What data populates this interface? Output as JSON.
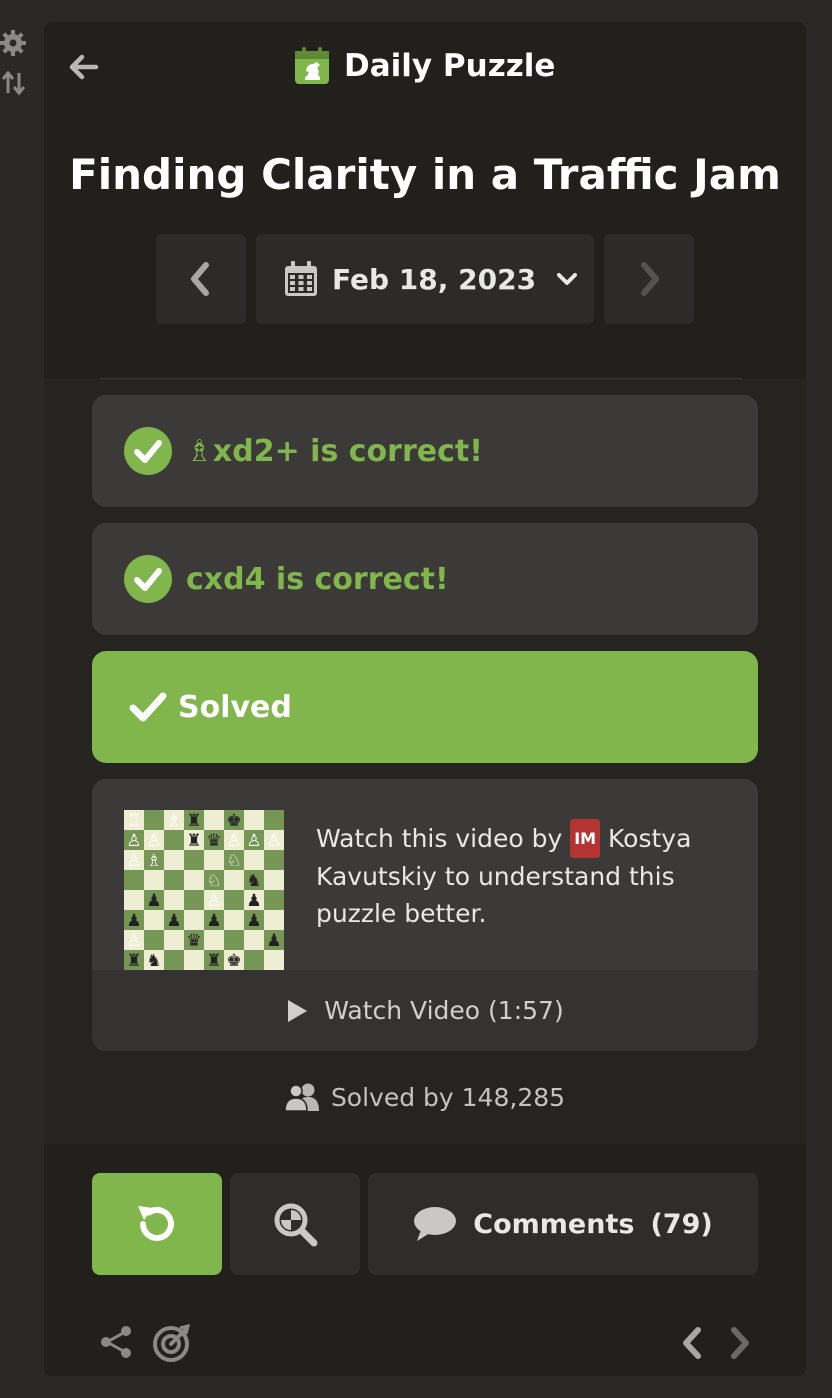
{
  "header": {
    "title": "Daily Puzzle",
    "puzzle_title": "Finding Clarity in a Traffic Jam",
    "date": "Feb 18, 2023"
  },
  "moves": [
    {
      "piece_glyph": "♗",
      "text": "xd2+ is correct!"
    },
    {
      "piece_glyph": "",
      "text": "cxd4 is correct!"
    }
  ],
  "solved_label": "Solved",
  "video": {
    "text_before": "Watch this video by",
    "title_badge": "IM",
    "text_after": "Kostya Kavutskiy to understand this puzzle better.",
    "watch_label": "Watch Video (1:57)"
  },
  "solved_by": "Solved by 148,285",
  "footer": {
    "comments_label": "Comments",
    "comments_count": "(79)"
  },
  "colors": {
    "accent_green": "#81b64c",
    "panel_bg": "#262421",
    "card_bg": "#3c3a38",
    "im_badge": "#b33430"
  },
  "icons": [
    "gear-icon",
    "flip-icon",
    "back-arrow-icon",
    "daily-puzzle-logo",
    "calendar-icon",
    "chevron-down-icon",
    "chevron-left-icon",
    "chevron-right-icon",
    "check-circle-icon",
    "checkmark-icon",
    "play-icon",
    "users-icon",
    "retry-icon",
    "analysis-icon",
    "comment-icon",
    "share-icon",
    "target-icon"
  ]
}
